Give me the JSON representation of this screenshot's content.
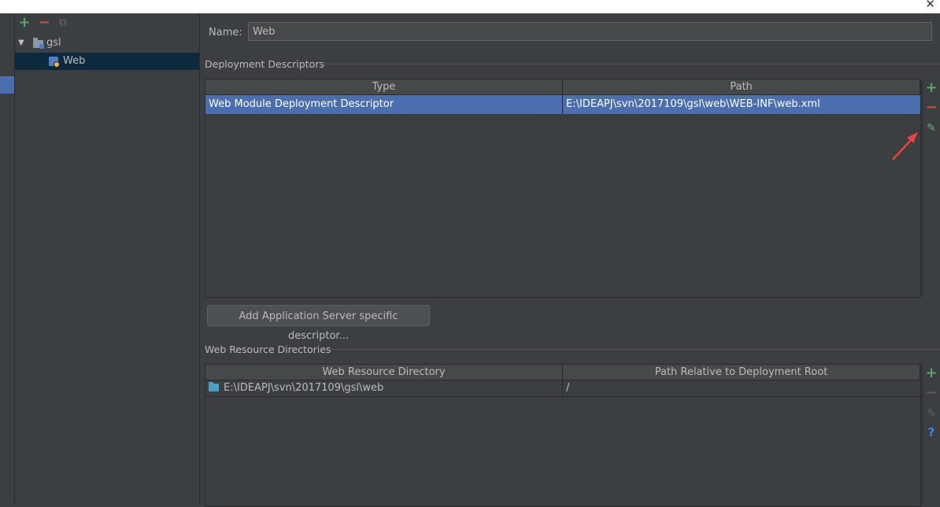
{
  "window": {
    "close_glyph": "✕"
  },
  "tree_toolbar": {
    "add": "+",
    "remove": "−",
    "copy": "⧉"
  },
  "tree": [
    {
      "label": "gsl",
      "expanded": true,
      "icon": "module-folder-icon"
    },
    {
      "label": "Web",
      "selected": true,
      "icon": "web-facet-icon"
    }
  ],
  "name_field": {
    "label": "Name:",
    "value": "Web"
  },
  "deployment": {
    "title": "Deployment Descriptors",
    "columns": [
      "Type",
      "Path"
    ],
    "rows": [
      {
        "type": "Web Module Deployment Descriptor",
        "path": "E:\\IDEAPJ\\svn\\2017109\\gsl\\web\\WEB-INF\\web.xml",
        "selected": true
      }
    ],
    "tools": {
      "add": "+",
      "remove": "−",
      "edit": "✎"
    },
    "button_label": "Add Application Server specific descriptor..."
  },
  "resources": {
    "title": "Web Resource Directories",
    "columns": [
      "Web Resource Directory",
      "Path Relative to Deployment Root"
    ],
    "rows": [
      {
        "dir": "E:\\IDEAPJ\\svn\\2017109\\gsl\\web",
        "rel": "/"
      }
    ],
    "tools": {
      "add": "+",
      "remove": "−",
      "edit": "✎",
      "help": "?"
    }
  },
  "colors": {
    "selection": "#4b6eaf",
    "add": "#59a869",
    "remove": "#c75450",
    "annotation_arrow": "#f0403c"
  }
}
